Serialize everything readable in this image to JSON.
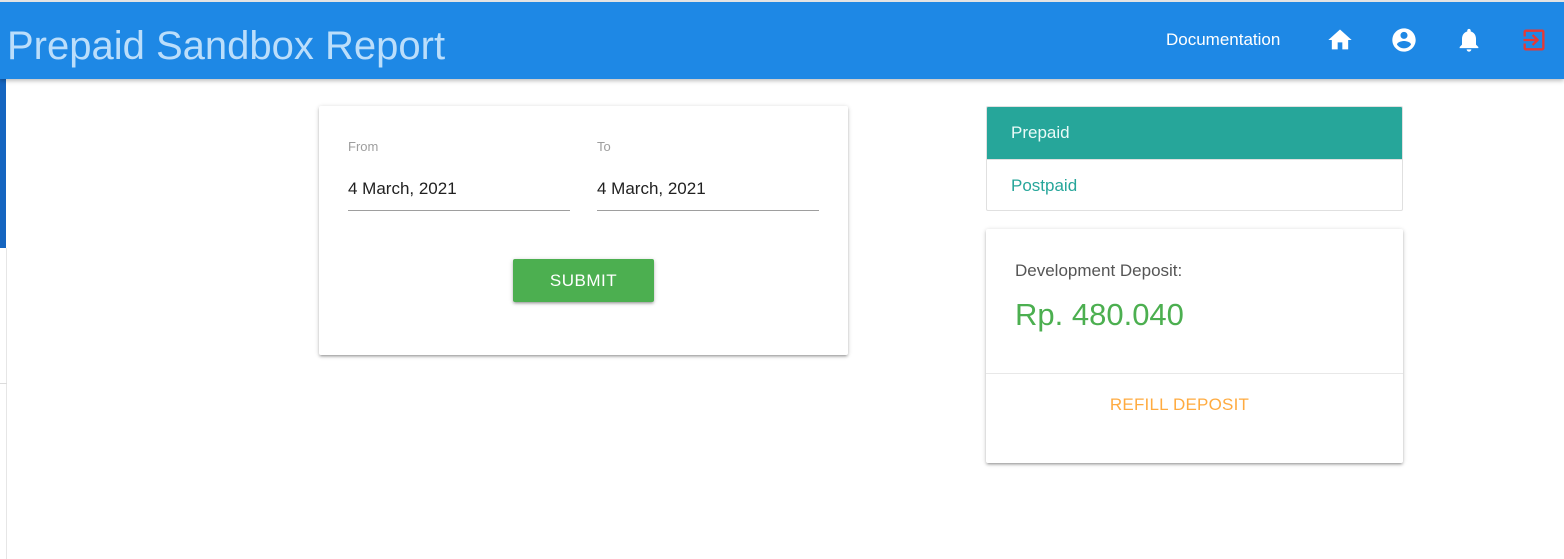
{
  "header": {
    "title": "Prepaid Sandbox Report",
    "nav": {
      "documentation": "Documentation",
      "icons": [
        "home-icon",
        "account-circle-icon",
        "notification-bell-icon",
        "logout-icon"
      ]
    }
  },
  "filter": {
    "from_label": "From",
    "from_value": "4 March, 2021",
    "to_label": "To",
    "to_value": "4 March, 2021",
    "submit_label": "SUBMIT"
  },
  "menu": {
    "items": [
      {
        "label": "Prepaid",
        "active": true
      },
      {
        "label": "Postpaid",
        "active": false
      }
    ]
  },
  "deposit": {
    "label": "Development Deposit:",
    "amount": "Rp. 480.040",
    "refill_label": "REFILL DEPOSIT"
  },
  "colors": {
    "header": "#1e88e5",
    "title_text": "#bbdefb",
    "submit": "#4caf50",
    "menu_active": "#26a69a",
    "amount": "#4caf50",
    "refill": "#ffab40",
    "logout": "#e53935"
  }
}
